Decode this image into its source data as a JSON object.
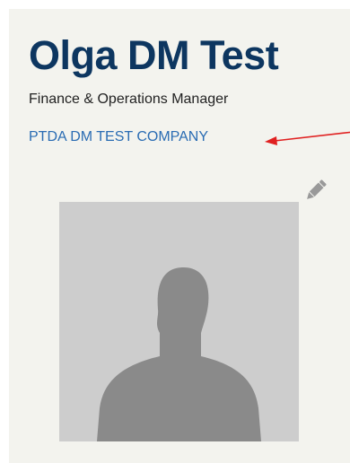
{
  "profile": {
    "name": "Olga DM Test",
    "title": "Finance & Operations Manager",
    "company": "PTDA DM TEST COMPANY"
  },
  "icons": {
    "edit": "pencil-icon",
    "avatar": "person-silhouette-icon",
    "annotation": "red-arrow-icon"
  },
  "colors": {
    "name": "#0d3660",
    "link": "#2a6cb3",
    "card_background": "#f3f3ee",
    "avatar_background": "#cdcdcd",
    "avatar_silhouette": "#8a8a8a",
    "annotation_arrow": "#e02020",
    "edit_icon": "#999999"
  }
}
